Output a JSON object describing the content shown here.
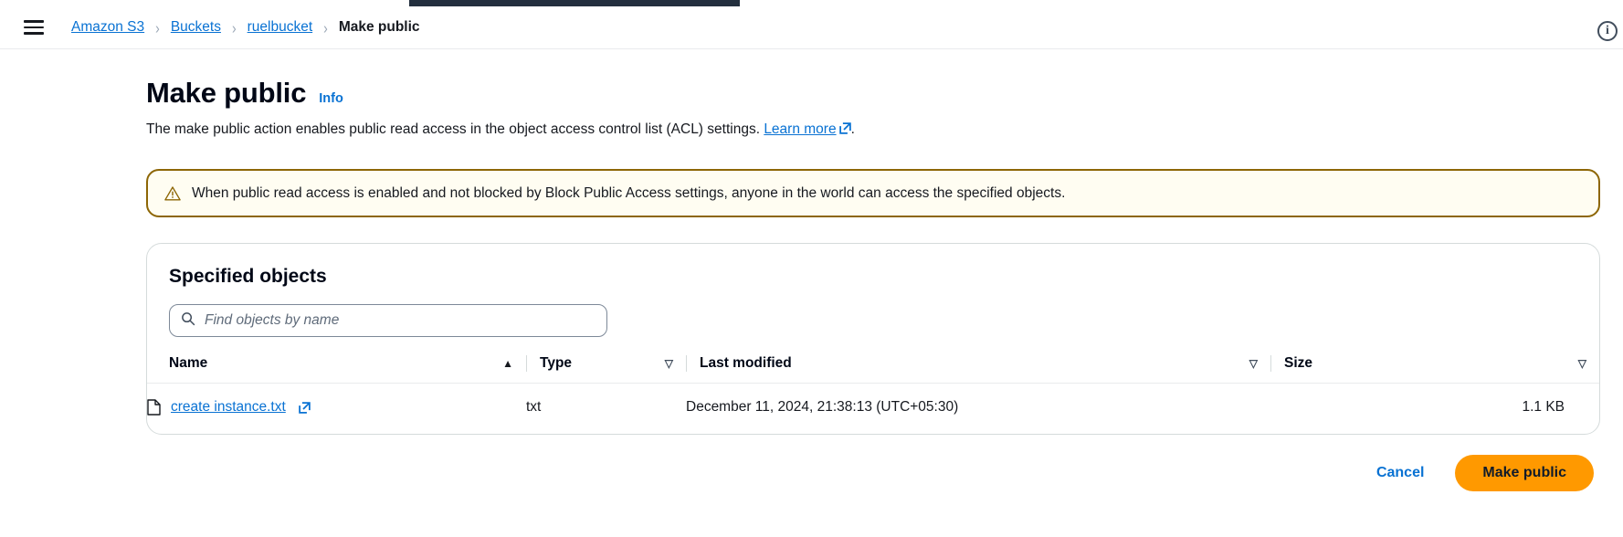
{
  "breadcrumb": {
    "items": [
      {
        "label": "Amazon S3",
        "current": false
      },
      {
        "label": "Buckets",
        "current": false
      },
      {
        "label": "ruelbucket",
        "current": false
      },
      {
        "label": "Make public",
        "current": true
      }
    ],
    "separator": "›"
  },
  "header": {
    "menu_icon": "hamburger-icon",
    "info_icon": "info-circle-icon"
  },
  "page": {
    "title": "Make public",
    "info_label": "Info",
    "description_before": "The make public action enables public read access in the object access control list (ACL) settings. ",
    "learn_more_label": "Learn more",
    "description_after": "."
  },
  "alert": {
    "icon": "warning-triangle-icon",
    "text": "When public read access is enabled and not blocked by Block Public Access settings, anyone in the world can access the specified objects.",
    "border_color": "#8d6605",
    "background_color": "#fffdf2"
  },
  "panel": {
    "title": "Specified objects",
    "search": {
      "placeholder": "Find objects by name",
      "value": "",
      "icon": "search-icon"
    },
    "table": {
      "columns": [
        {
          "label": "Name",
          "sort": "ascending",
          "sort_glyph": "▲"
        },
        {
          "label": "Type",
          "sort": "none",
          "sort_glyph": "▽"
        },
        {
          "label": "Last modified",
          "sort": "none",
          "sort_glyph": "▽"
        },
        {
          "label": "Size",
          "sort": "none",
          "sort_glyph": "▽"
        }
      ],
      "rows": [
        {
          "name": "create instance.txt",
          "file_icon": "file-document-icon",
          "link_icon": "external-link-icon",
          "type": "txt",
          "last_modified": "December 11, 2024, 21:38:13 (UTC+05:30)",
          "size": "1.1 KB"
        }
      ]
    }
  },
  "actions": {
    "cancel_label": "Cancel",
    "submit_label": "Make public",
    "submit_color": "#ff9900",
    "link_color": "#0972d3"
  }
}
